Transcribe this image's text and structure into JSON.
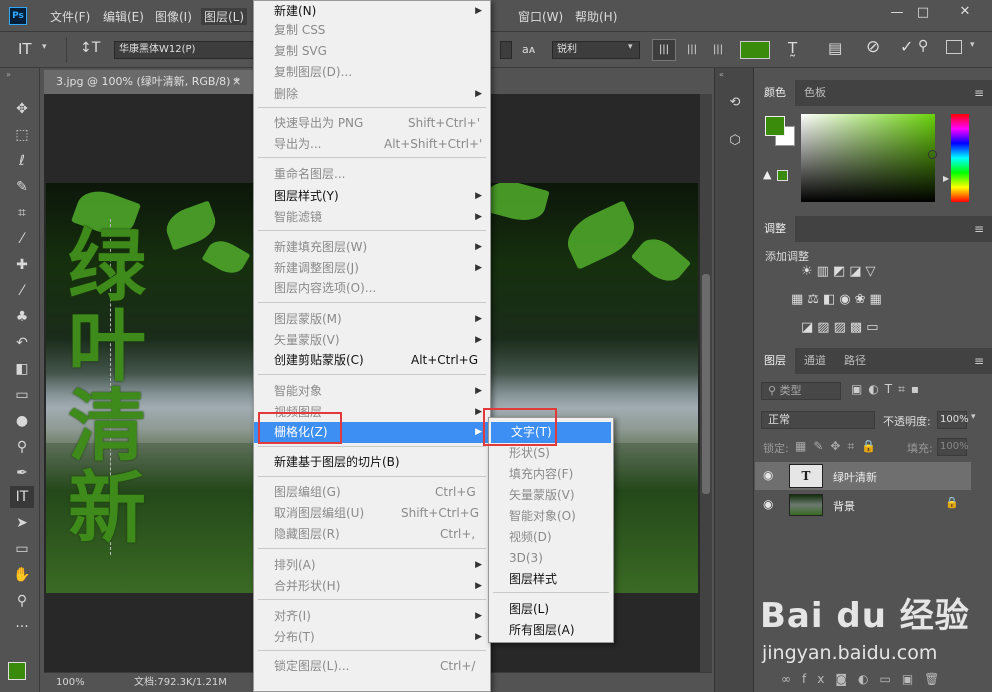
{
  "menubar": {
    "logo": "Ps",
    "items": [
      "文件(F)",
      "编辑(E)",
      "图像(I)",
      "图层(L)",
      "窗口(W)",
      "帮助(H)"
    ],
    "window_controls": {
      "minimize": "—",
      "restore": "□",
      "close": "✕"
    }
  },
  "options_bar": {
    "font_family": "华康黑体W12(P)",
    "aa_label": "aᴀ",
    "aa_mode": "锐利",
    "color": "#3a8a0c"
  },
  "document": {
    "tab_title": "3.jpg @ 100% (绿叶清新, RGB/8) *",
    "title_chars": [
      "绿",
      "叶",
      "清",
      "新"
    ]
  },
  "status": {
    "zoom": "100%",
    "doc_info": "文档:792.3K/1.21M"
  },
  "layer_menu": {
    "items": [
      {
        "label": "新建(N)",
        "arrow": true
      },
      {
        "label": "复制 CSS",
        "disabled": true
      },
      {
        "label": "复制 SVG",
        "disabled": true
      },
      {
        "label": "复制图层(D)...",
        "disabled": true
      },
      {
        "label": "删除",
        "disabled": true,
        "arrow": true
      },
      {
        "label": "快速导出为 PNG",
        "shortcut": "Shift+Ctrl+'",
        "disabled": true
      },
      {
        "label": "导出为...",
        "shortcut": "Alt+Shift+Ctrl+'",
        "disabled": true
      },
      {
        "label": "重命名图层...",
        "disabled": true
      },
      {
        "label": "图层样式(Y)",
        "arrow": true
      },
      {
        "label": "智能滤镜",
        "disabled": true,
        "arrow": true
      },
      {
        "label": "新建填充图层(W)",
        "disabled": true,
        "arrow": true
      },
      {
        "label": "新建调整图层(J)",
        "disabled": true,
        "arrow": true
      },
      {
        "label": "图层内容选项(O)...",
        "disabled": true
      },
      {
        "label": "图层蒙版(M)",
        "disabled": true,
        "arrow": true
      },
      {
        "label": "矢量蒙版(V)",
        "disabled": true,
        "arrow": true
      },
      {
        "label": "创建剪贴蒙版(C)",
        "shortcut": "Alt+Ctrl+G"
      },
      {
        "label": "智能对象",
        "disabled": true,
        "arrow": true
      },
      {
        "label": "视频图层",
        "disabled": true,
        "arrow": true
      },
      {
        "label": "栅格化(Z)",
        "highlighted": true,
        "arrow": true
      },
      {
        "label": "新建基于图层的切片(B)"
      },
      {
        "label": "图层编组(G)",
        "shortcut": "Ctrl+G",
        "disabled": true
      },
      {
        "label": "取消图层编组(U)",
        "shortcut": "Shift+Ctrl+G",
        "disabled": true
      },
      {
        "label": "隐藏图层(R)",
        "shortcut": "Ctrl+,",
        "disabled": true
      },
      {
        "label": "排列(A)",
        "disabled": true,
        "arrow": true
      },
      {
        "label": "合并形状(H)",
        "disabled": true,
        "arrow": true
      },
      {
        "label": "对齐(I)",
        "disabled": true,
        "arrow": true
      },
      {
        "label": "分布(T)",
        "disabled": true,
        "arrow": true
      },
      {
        "label": "锁定图层(L)...",
        "shortcut": "Ctrl+/",
        "disabled": true
      }
    ]
  },
  "rasterize_submenu": {
    "items": [
      {
        "label": "文字(T)",
        "highlighted": true
      },
      {
        "label": "形状(S)",
        "disabled": true
      },
      {
        "label": "填充内容(F)",
        "disabled": true
      },
      {
        "label": "矢量蒙版(V)",
        "disabled": true
      },
      {
        "label": "智能对象(O)",
        "disabled": true
      },
      {
        "label": "视频(D)",
        "disabled": true
      },
      {
        "label": "3D(3)",
        "disabled": true
      },
      {
        "label": "图层样式"
      },
      {
        "label": "图层(L)"
      },
      {
        "label": "所有图层(A)"
      }
    ]
  },
  "color_panel": {
    "tabs": [
      "颜色",
      "色板"
    ],
    "foreground": "#3a8a0c",
    "background": "#ffffff",
    "field_hue": "#6ad20a"
  },
  "adjustments_panel": {
    "tab": "调整",
    "title": "添加调整"
  },
  "layers_panel": {
    "tabs": [
      "图层",
      "通道",
      "路径"
    ],
    "filter_kind": "类型",
    "blend_mode": "正常",
    "opacity_label": "不透明度:",
    "opacity_value": "100%",
    "lock_label": "锁定:",
    "fill_label": "填充:",
    "fill_value": "100%",
    "layers": [
      {
        "name": "绿叶清新",
        "type": "text",
        "thumb": "T"
      },
      {
        "name": "背景",
        "type": "image"
      }
    ]
  },
  "watermark": {
    "brand": "Bai du 经验",
    "url": "jingyan.baidu.com"
  }
}
